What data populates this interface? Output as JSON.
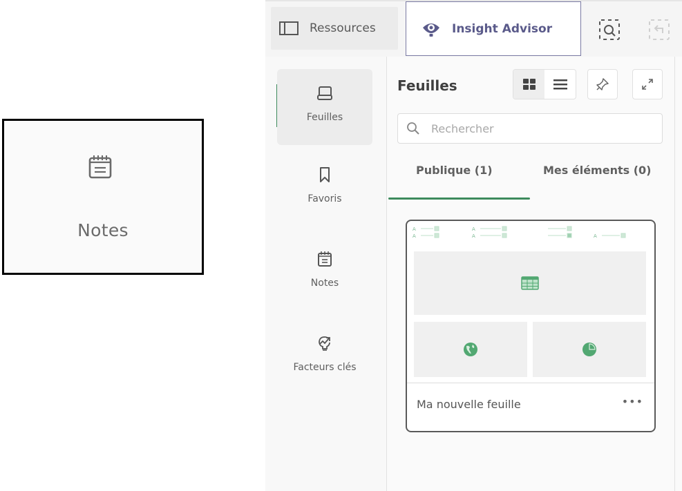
{
  "callout": {
    "label": "Notes",
    "icon": "notes-calendar-icon"
  },
  "topbar": {
    "resources_label": "Ressources",
    "resources_icon": "panel-icon",
    "insight_label": "Insight Advisor",
    "insight_icon": "lightbulb-eye-icon",
    "smart_search_icon": "smart-search-icon",
    "step_back_icon": "step-back-icon"
  },
  "sidebar": {
    "items": [
      {
        "label": "Feuilles",
        "icon": "sheet-icon",
        "active": true
      },
      {
        "label": "Favoris",
        "icon": "bookmark-icon",
        "active": false
      },
      {
        "label": "Notes",
        "icon": "notes-icon",
        "active": false
      },
      {
        "label": "Facteurs clés",
        "icon": "key-drivers-icon",
        "active": false
      }
    ]
  },
  "main": {
    "title": "Feuilles",
    "view_modes": [
      "grid",
      "list"
    ],
    "active_view": "grid",
    "search_placeholder": "Rechercher",
    "search_value": "",
    "tabs": [
      {
        "label": "Publique (1)",
        "active": true
      },
      {
        "label": "Mes éléments (0)",
        "active": false
      }
    ],
    "sheets": [
      {
        "name": "Ma nouvelle feuille",
        "more_label": "•••"
      }
    ]
  },
  "colors": {
    "accent_green": "#3d8a5c",
    "thumbnail_green": "#52a872",
    "insight_purple": "#5a5a8a"
  }
}
